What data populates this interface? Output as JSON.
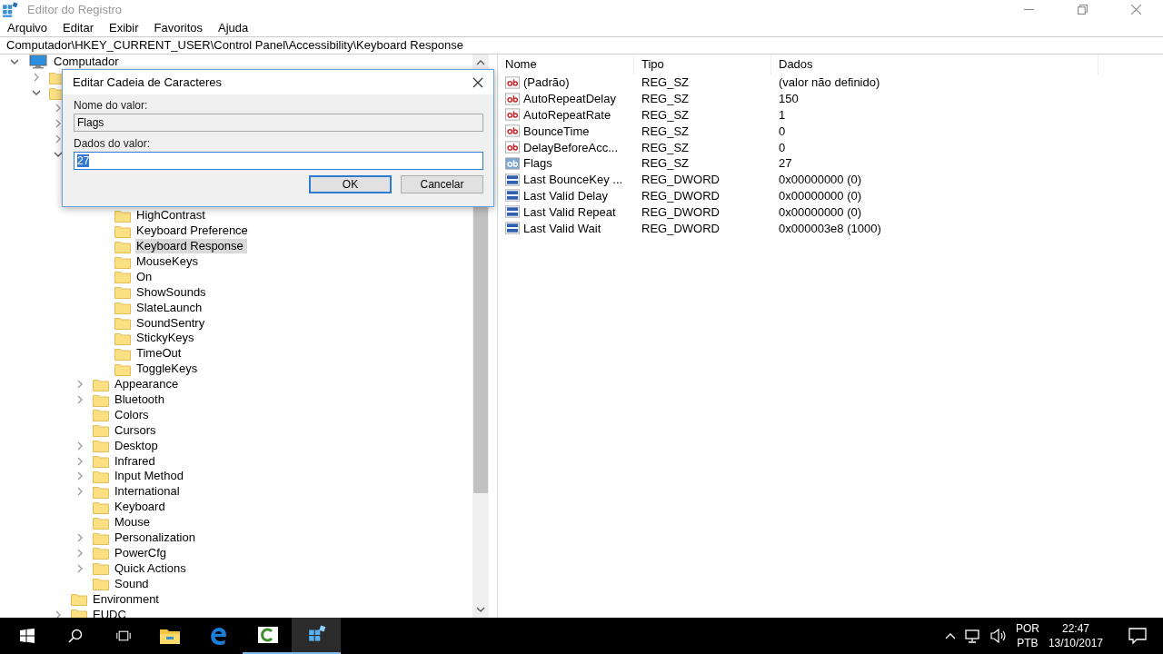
{
  "window": {
    "title": "Editor do Registro"
  },
  "menu": [
    "Arquivo",
    "Editar",
    "Exibir",
    "Favoritos",
    "Ajuda"
  ],
  "address": "Computador\\HKEY_CURRENT_USER\\Control Panel\\Accessibility\\Keyboard Response",
  "tree": [
    {
      "label": "Computador",
      "kind": "computer",
      "expanded": true,
      "selected": false,
      "children": [
        {
          "kind": "folder",
          "expanded": false
        },
        {
          "kind": "folder",
          "expanded": true,
          "children": [
            {
              "kind": "folder",
              "expanded": false
            },
            {
              "kind": "folder",
              "expanded": false
            },
            {
              "kind": "folder",
              "expanded": false
            },
            {
              "kind": "folder",
              "expanded": true,
              "children": [
                {
                  "kind": "folder",
                  "children": [
                    {
                      "kind": "folder"
                    },
                    {
                      "kind": "folder"
                    },
                    {
                      "label": "HighContrast",
                      "kind": "folder",
                      "selected": false
                    },
                    {
                      "label": "Keyboard Preference",
                      "kind": "folder",
                      "selected": false
                    },
                    {
                      "label": "Keyboard Response",
                      "kind": "folder",
                      "selected": true
                    },
                    {
                      "label": "MouseKeys",
                      "kind": "folder",
                      "selected": false
                    },
                    {
                      "label": "On",
                      "kind": "folder",
                      "selected": false
                    },
                    {
                      "label": "ShowSounds",
                      "kind": "folder",
                      "selected": false
                    },
                    {
                      "label": "SlateLaunch",
                      "kind": "folder",
                      "selected": false
                    },
                    {
                      "label": "SoundSentry",
                      "kind": "folder",
                      "selected": false
                    },
                    {
                      "label": "StickyKeys",
                      "kind": "folder",
                      "selected": false
                    },
                    {
                      "label": "TimeOut",
                      "kind": "folder",
                      "selected": false
                    },
                    {
                      "label": "ToggleKeys",
                      "kind": "folder",
                      "selected": false
                    }
                  ]
                },
                {
                  "label": "Appearance",
                  "kind": "folder",
                  "expanded": false,
                  "selected": false
                },
                {
                  "label": "Bluetooth",
                  "kind": "folder",
                  "expanded": false,
                  "selected": false
                },
                {
                  "label": "Colors",
                  "kind": "folder",
                  "selected": false
                },
                {
                  "label": "Cursors",
                  "kind": "folder",
                  "selected": false
                },
                {
                  "label": "Desktop",
                  "kind": "folder",
                  "expanded": false,
                  "selected": false
                },
                {
                  "label": "Infrared",
                  "kind": "folder",
                  "expanded": false,
                  "selected": false
                },
                {
                  "label": "Input Method",
                  "kind": "folder",
                  "expanded": false,
                  "selected": false
                },
                {
                  "label": "International",
                  "kind": "folder",
                  "expanded": false,
                  "selected": false
                },
                {
                  "label": "Keyboard",
                  "kind": "folder",
                  "selected": false
                },
                {
                  "label": "Mouse",
                  "kind": "folder",
                  "selected": false
                },
                {
                  "label": "Personalization",
                  "kind": "folder",
                  "expanded": false,
                  "selected": false
                },
                {
                  "label": "PowerCfg",
                  "kind": "folder",
                  "expanded": false,
                  "selected": false
                },
                {
                  "label": "Quick Actions",
                  "kind": "folder",
                  "expanded": false,
                  "selected": false
                },
                {
                  "label": "Sound",
                  "kind": "folder",
                  "selected": false
                }
              ]
            },
            {
              "label": "Environment",
              "kind": "folder",
              "selected": false
            },
            {
              "label": "EUDC",
              "kind": "folder",
              "expanded": false,
              "selected": false
            }
          ]
        }
      ]
    }
  ],
  "values": {
    "columns": [
      "Nome",
      "Tipo",
      "Dados"
    ],
    "rows": [
      {
        "name": "(Padrão)",
        "type": "REG_SZ",
        "data": "(valor não definido)",
        "kind": "string",
        "selected": false
      },
      {
        "name": "AutoRepeatDelay",
        "type": "REG_SZ",
        "data": "150",
        "kind": "string",
        "selected": false
      },
      {
        "name": "AutoRepeatRate",
        "type": "REG_SZ",
        "data": "1",
        "kind": "string",
        "selected": false
      },
      {
        "name": "BounceTime",
        "type": "REG_SZ",
        "data": "0",
        "kind": "string",
        "selected": false
      },
      {
        "name": "DelayBeforeAcc...",
        "type": "REG_SZ",
        "data": "0",
        "kind": "string",
        "selected": false
      },
      {
        "name": "Flags",
        "type": "REG_SZ",
        "data": "27",
        "kind": "string",
        "selected": true
      },
      {
        "name": "Last BounceKey ...",
        "type": "REG_DWORD",
        "data": "0x00000000 (0)",
        "kind": "binary",
        "selected": false
      },
      {
        "name": "Last Valid Delay",
        "type": "REG_DWORD",
        "data": "0x00000000 (0)",
        "kind": "binary",
        "selected": false
      },
      {
        "name": "Last Valid Repeat",
        "type": "REG_DWORD",
        "data": "0x00000000 (0)",
        "kind": "binary",
        "selected": false
      },
      {
        "name": "Last Valid Wait",
        "type": "REG_DWORD",
        "data": "0x000003e8 (1000)",
        "kind": "binary",
        "selected": false
      }
    ]
  },
  "dialog": {
    "title": "Editar Cadeia de Caracteres",
    "name_label": "Nome do valor:",
    "name_value": "Flags",
    "data_label": "Dados do valor:",
    "data_value": "27",
    "buttons": [
      "OK",
      "Cancelar"
    ]
  },
  "taskbar": {
    "language": "POR",
    "layout": "PTB",
    "time": "22:47",
    "date": "13/10/2017"
  }
}
